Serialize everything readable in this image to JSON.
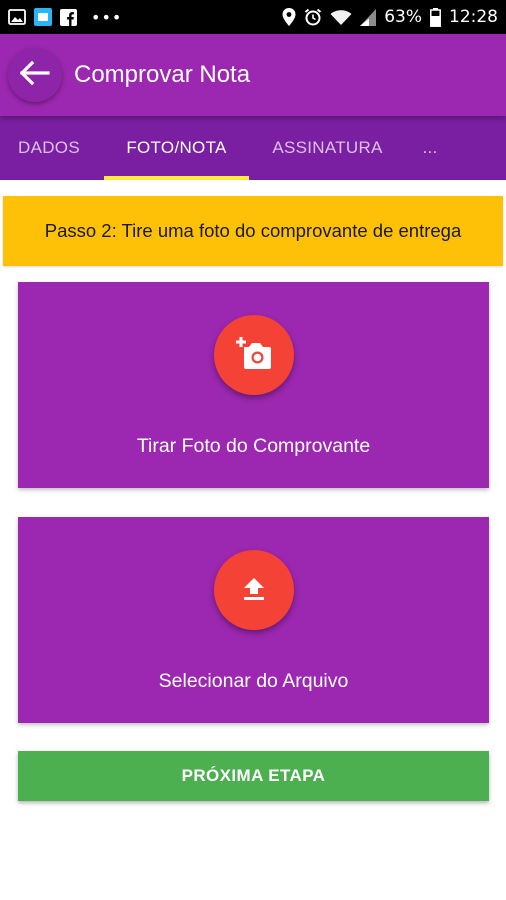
{
  "status_bar": {
    "icons_left": [
      "gallery-icon",
      "app-icon",
      "facebook-icon"
    ],
    "more_dots": "•••",
    "icons_right": [
      "location-icon",
      "alarm-icon",
      "wifi-icon",
      "signal-icon",
      "battery-icon"
    ],
    "battery": "63%",
    "time": "12:28"
  },
  "app_bar": {
    "title": "Comprovar Nota",
    "back_icon": "arrow-left-icon"
  },
  "tabs": [
    {
      "label": "DADOS",
      "active": false
    },
    {
      "label": "FOTO/NOTA",
      "active": true
    },
    {
      "label": "ASSINATURA",
      "active": false
    },
    {
      "label": "...",
      "active": false
    }
  ],
  "step_banner": "Passo 2: Tire uma foto do comprovante de entrega",
  "cards": {
    "take_photo": {
      "label": "Tirar Foto do Comprovante",
      "icon": "add-photo-icon"
    },
    "select_file": {
      "label": "Selecionar do Arquivo",
      "icon": "upload-icon"
    }
  },
  "next_button": "PRÓXIMA ETAPA",
  "colors": {
    "status_bar": "#000000",
    "primary": "#9c27b0",
    "tabs": "#7b1fa2",
    "tab_indicator": "#ffeb3b",
    "banner": "#ffc107",
    "fab": "#f44336",
    "next_button": "#4caf50"
  }
}
